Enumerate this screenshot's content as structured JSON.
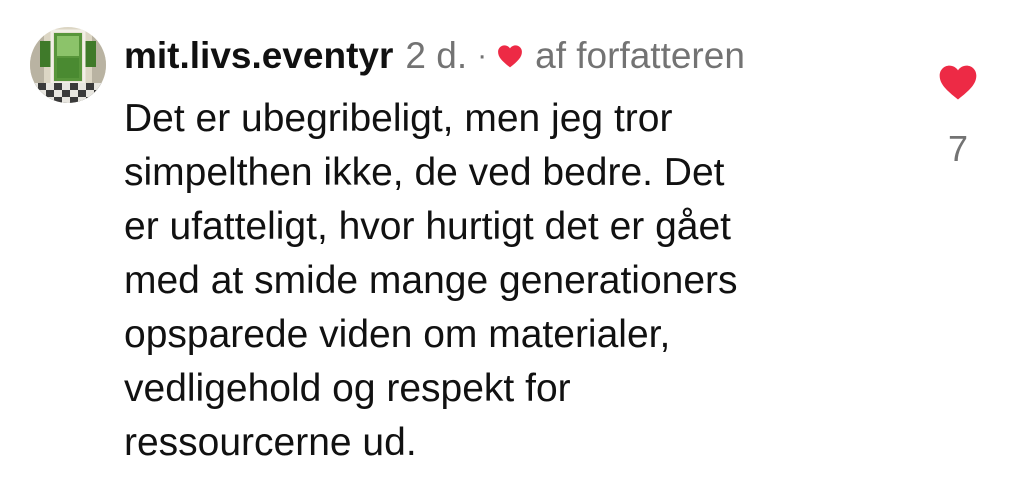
{
  "comment": {
    "username": "mit.livs.eventyr",
    "time_ago": "2 d.",
    "separator": "·",
    "author_liked_label": "af forfatteren",
    "text": "Det er ubegribeligt, men jeg tror\nsimpelthen ikke, de ved bedre. Det\ner ufatteligt, hvor hurtigt det er gået\nmed at smide mange generationers\nopsparede viden om materialer,\nvedligehold og respekt for\nressourcerne ud.",
    "like_count": "7",
    "liked": true
  },
  "icons": {
    "avatar": "avatar-garden-doorway-icon",
    "author_heart": "heart-filled-icon",
    "like": "heart-filled-icon"
  },
  "colors": {
    "heart": "#ED2A45",
    "text": "#111111",
    "secondary": "#737373"
  }
}
